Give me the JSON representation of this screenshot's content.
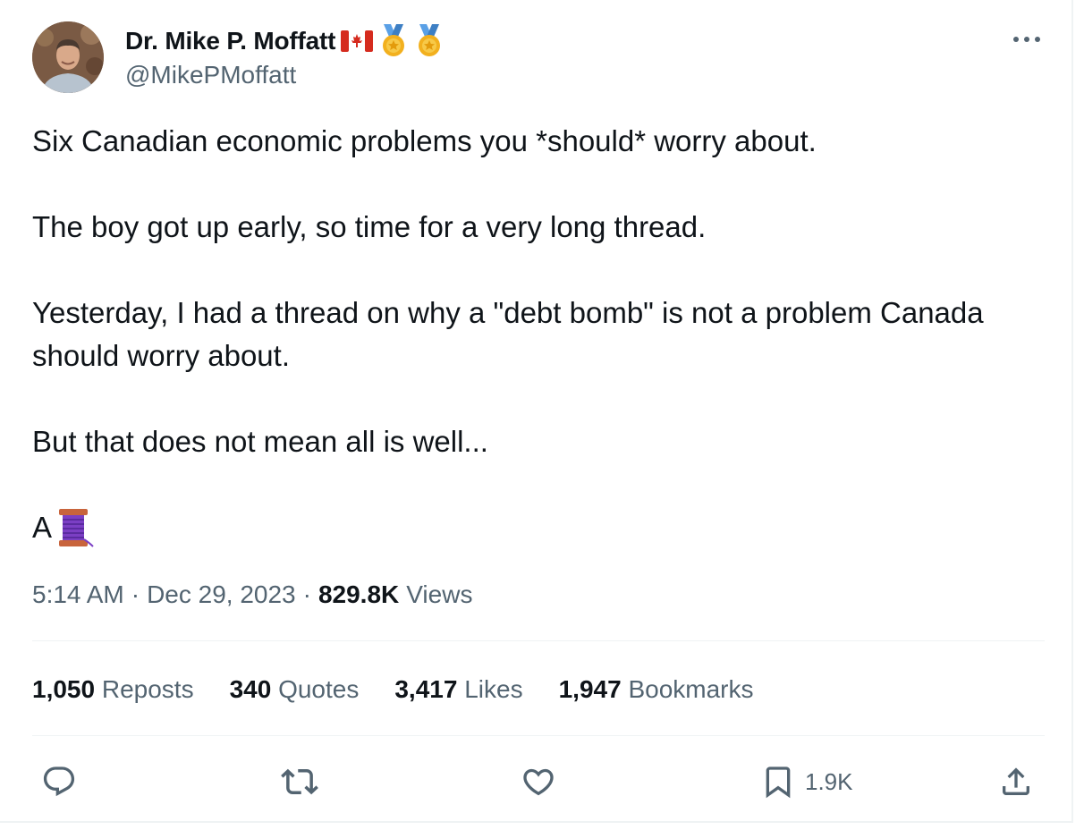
{
  "author": {
    "display_name": "Dr. Mike P. Moffatt",
    "handle": "@MikePMoffatt",
    "badges": [
      "canada-flag-icon",
      "gold-medal-icon",
      "gold-medal-icon"
    ]
  },
  "tweet": {
    "paragraphs": [
      "Six Canadian economic problems you *should* worry about.",
      "The boy got up early, so time for a very long thread.",
      "Yesterday, I had a thread on why a \"debt bomb\" is not a problem Canada should worry about.",
      "But that does not mean all is well..."
    ],
    "closing_text": "A",
    "closing_emoji": "thread-spool-icon"
  },
  "meta": {
    "time": "5:14 AM",
    "date": "Dec 29, 2023",
    "separator": "·",
    "views_count": "829.8K",
    "views_label": "Views"
  },
  "stats": [
    {
      "count": "1,050",
      "label": "Reposts"
    },
    {
      "count": "340",
      "label": "Quotes"
    },
    {
      "count": "3,417",
      "label": "Likes"
    },
    {
      "count": "1,947",
      "label": "Bookmarks"
    }
  ],
  "actions": {
    "reply_icon": "reply-icon",
    "repost_icon": "repost-icon",
    "like_icon": "heart-icon",
    "bookmark_icon": "bookmark-icon",
    "bookmark_count": "1.9K",
    "share_icon": "share-icon"
  },
  "colors": {
    "text_primary": "#0f1419",
    "text_secondary": "#536471",
    "divider": "#eff3f4",
    "spool_purple": "#7b3fc4",
    "spool_wood": "#c8643c",
    "medal_gold": "#f2b01e",
    "medal_ribbon": "#5aa0e6",
    "flag_red": "#d52b1e"
  }
}
